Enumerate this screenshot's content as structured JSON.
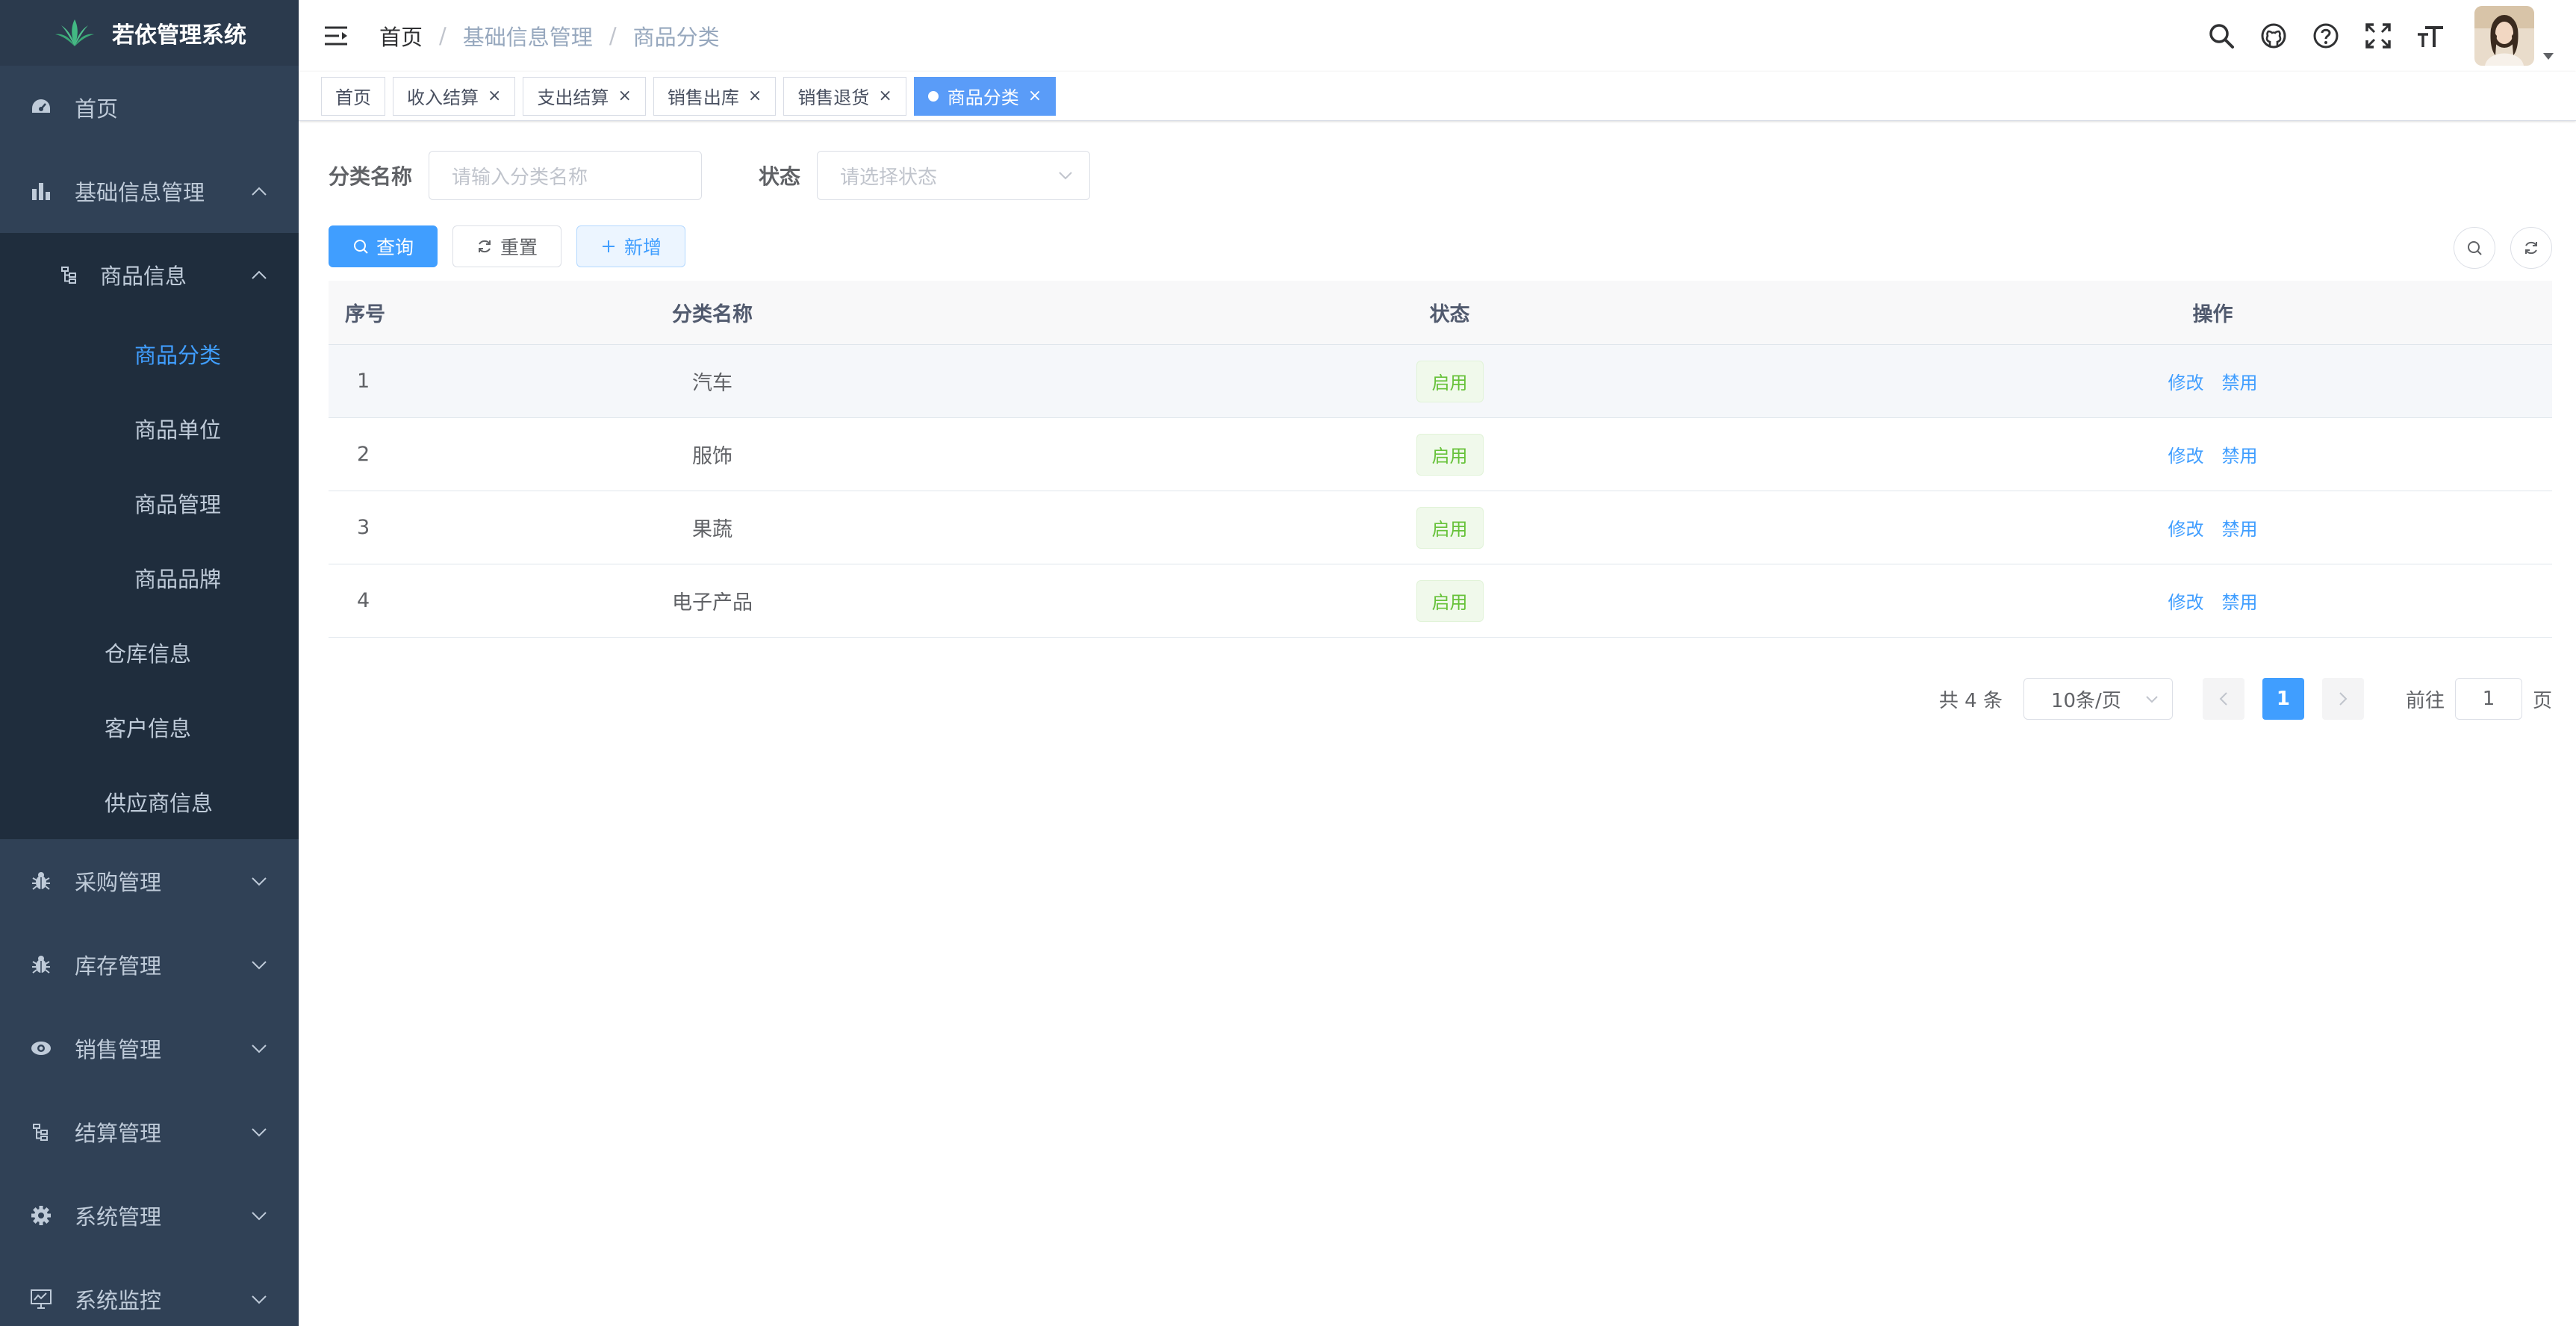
{
  "sidebar": {
    "logo_title": "若依管理系统",
    "items": [
      {
        "label": "首页",
        "icon": "dashboard-icon"
      },
      {
        "label": "基础信息管理",
        "icon": "bar-chart-icon"
      },
      {
        "label": "商品信息",
        "icon": "tree-icon"
      },
      {
        "label": "商品分类"
      },
      {
        "label": "商品单位"
      },
      {
        "label": "商品管理"
      },
      {
        "label": "商品品牌"
      },
      {
        "label": "仓库信息"
      },
      {
        "label": "客户信息"
      },
      {
        "label": "供应商信息"
      },
      {
        "label": "采购管理",
        "icon": "bug-icon"
      },
      {
        "label": "库存管理",
        "icon": "bug-icon"
      },
      {
        "label": "销售管理",
        "icon": "eye-icon"
      },
      {
        "label": "结算管理",
        "icon": "tree-icon"
      },
      {
        "label": "系统管理",
        "icon": "gear-icon"
      },
      {
        "label": "系统监控",
        "icon": "monitor-icon"
      }
    ],
    "active_color": "#409eff"
  },
  "header": {
    "breadcrumb": [
      "首页",
      "基础信息管理",
      "商品分类"
    ],
    "breadcrumb_sep": "/"
  },
  "tags": [
    {
      "label": "首页"
    },
    {
      "label": "收入结算"
    },
    {
      "label": "支出结算"
    },
    {
      "label": "销售出库"
    },
    {
      "label": "销售退货"
    },
    {
      "label": "商品分类"
    }
  ],
  "tag_close": "×",
  "query": {
    "name_label": "分类名称",
    "name_placeholder": "请输入分类名称",
    "status_label": "状态",
    "status_placeholder": "请选择状态"
  },
  "buttons": {
    "search": "查询",
    "reset": "重置",
    "add": "新增"
  },
  "table": {
    "columns": [
      "序号",
      "分类名称",
      "状态",
      "操作"
    ],
    "rows": [
      {
        "idx": "1",
        "name": "汽车",
        "status": "启用",
        "edit": "修改",
        "disable": "禁用"
      },
      {
        "idx": "2",
        "name": "服饰",
        "status": "启用",
        "edit": "修改",
        "disable": "禁用"
      },
      {
        "idx": "3",
        "name": "果蔬",
        "status": "启用",
        "edit": "修改",
        "disable": "禁用"
      },
      {
        "idx": "4",
        "name": "电子产品",
        "status": "启用",
        "edit": "修改",
        "disable": "禁用"
      }
    ]
  },
  "pagination": {
    "total": "共 4 条",
    "page_size": "10条/页",
    "current": "1",
    "goto_label": "前往",
    "goto_value": "1",
    "page_suffix": "页"
  },
  "colors": {
    "sidebar_bg": "#304156",
    "primary": "#409eff",
    "success": "#67c23a"
  }
}
